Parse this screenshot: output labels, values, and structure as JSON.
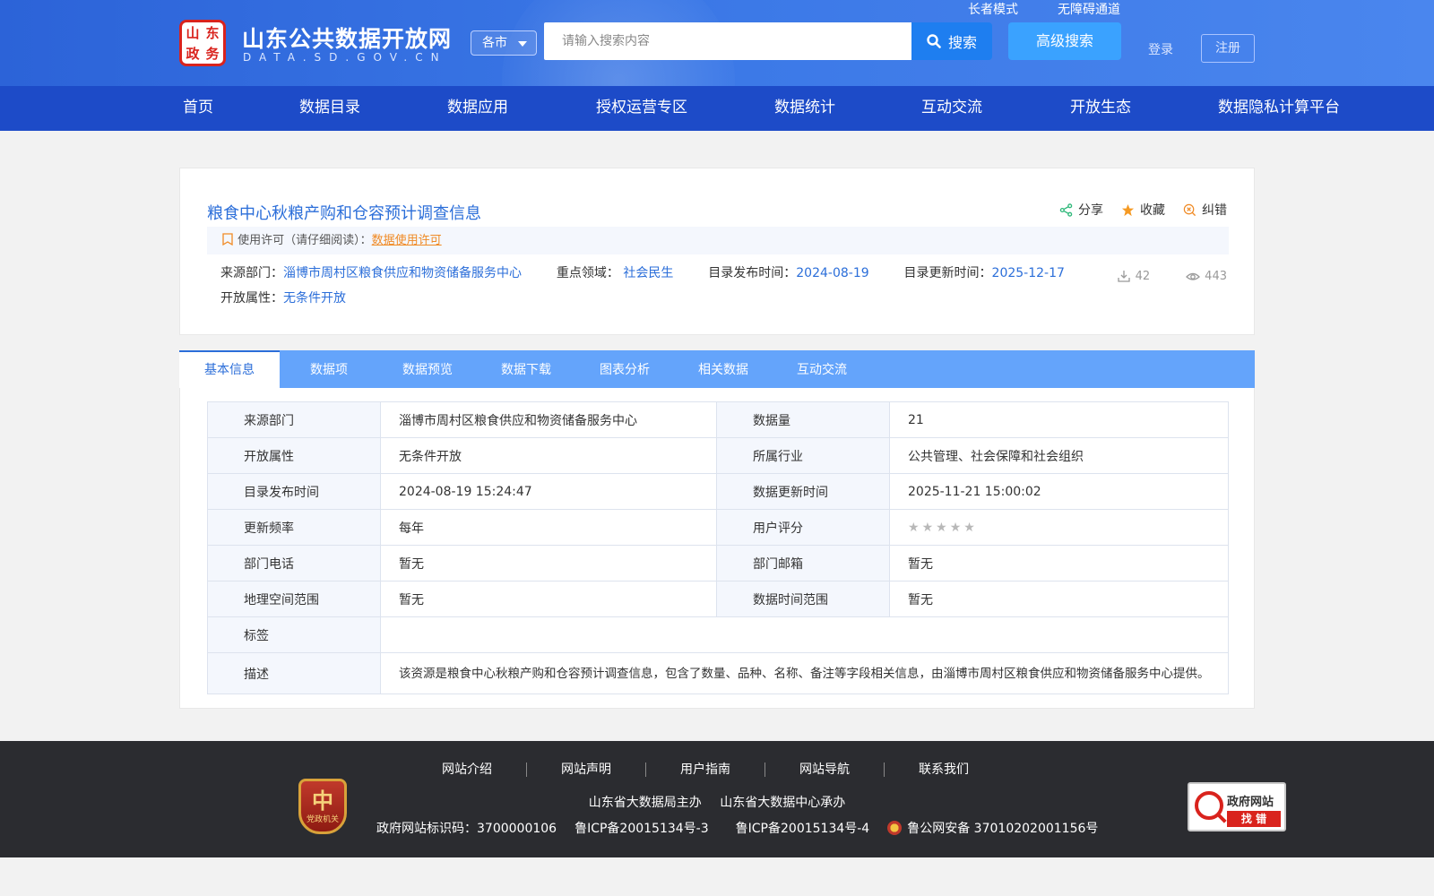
{
  "header": {
    "logo_seal_chars": [
      "山",
      "东",
      "政",
      "务"
    ],
    "site_title": "山东公共数据开放网",
    "site_subtitle": "DATA.SD.GOV.CN",
    "city_select": "各市",
    "search_placeholder": "请输入搜索内容",
    "search_button": "搜索",
    "advanced_search_button": "高级搜索",
    "elder_mode": "长者模式",
    "accessibility": "无障碍通道",
    "login": "登录",
    "register": "注册"
  },
  "nav": {
    "items": [
      "首页",
      "数据目录",
      "数据应用",
      "授权运营专区",
      "数据统计",
      "互动交流",
      "开放生态",
      "数据隐私计算平台"
    ]
  },
  "dataset": {
    "title": "粮食中心秋粮产购和仓容预计调查信息",
    "actions": {
      "share": "分享",
      "favorite": "收藏",
      "report_error": "纠错"
    },
    "license_label": "使用许可（请仔细阅读）：",
    "license_link": "数据使用许可",
    "source_label": "来源部门：",
    "source_value": "淄博市周村区粮食供应和物资储备服务中心",
    "field_label": "重点领域：",
    "field_value": "社会民生",
    "publish_label": "目录发布时间：",
    "publish_value": "2024-08-19",
    "update_label": "目录更新时间：",
    "update_value": "2025-12-17",
    "open_label": "开放属性：",
    "open_value": "无条件开放",
    "downloads": "42",
    "views": "443"
  },
  "tabs": [
    "基本信息",
    "数据项",
    "数据预览",
    "数据下载",
    "图表分析",
    "相关数据",
    "互动交流"
  ],
  "info_table": {
    "rows": [
      {
        "l1": "来源部门",
        "v1": "淄博市周村区粮食供应和物资储备服务中心",
        "l2": "数据量",
        "v2": "21"
      },
      {
        "l1": "开放属性",
        "v1": "无条件开放",
        "l2": "所属行业",
        "v2": "公共管理、社会保障和社会组织"
      },
      {
        "l1": "目录发布时间",
        "v1": "2024-08-19 15:24:47",
        "l2": "数据更新时间",
        "v2": "2025-11-21 15:00:02"
      },
      {
        "l1": "更新频率",
        "v1": "每年",
        "l2": "用户评分",
        "v2": ""
      },
      {
        "l1": "部门电话",
        "v1": "暂无",
        "l2": "部门邮箱",
        "v2": "暂无"
      },
      {
        "l1": "地理空间范围",
        "v1": "暂无",
        "l2": "数据时间范围",
        "v2": "暂无"
      }
    ],
    "tag_label": "标签",
    "tag_value": "",
    "desc_label": "描述",
    "desc_value": "该资源是粮食中心秋粮产购和仓容预计调查信息，包含了数量、品种、名称、备注等字段相关信息，由淄博市周村区粮食供应和物资储备服务中心提供。",
    "rating_stars": 0
  },
  "footer": {
    "links": [
      "网站介绍",
      "网站声明",
      "用户指南",
      "网站导航",
      "联系我们"
    ],
    "sponsor": "山东省大数据局主办",
    "organizer": "山东省大数据中心承办",
    "site_code": "政府网站标识码：3700000106",
    "icp1": "鲁ICP备20015134号-3",
    "icp2": "鲁ICP备20015134号-4",
    "police": "鲁公网安备 37010202001156号",
    "party_badge_char": "中",
    "party_badge_text": "党政机关",
    "gov_err_title": "政府网站",
    "gov_err_sub": "找 错"
  },
  "colors": {
    "brand_blue": "#2b6ed9",
    "nav_blue": "#1d4bc8",
    "tab_blue": "#64a4fb",
    "accent_orange": "#f08a24"
  }
}
